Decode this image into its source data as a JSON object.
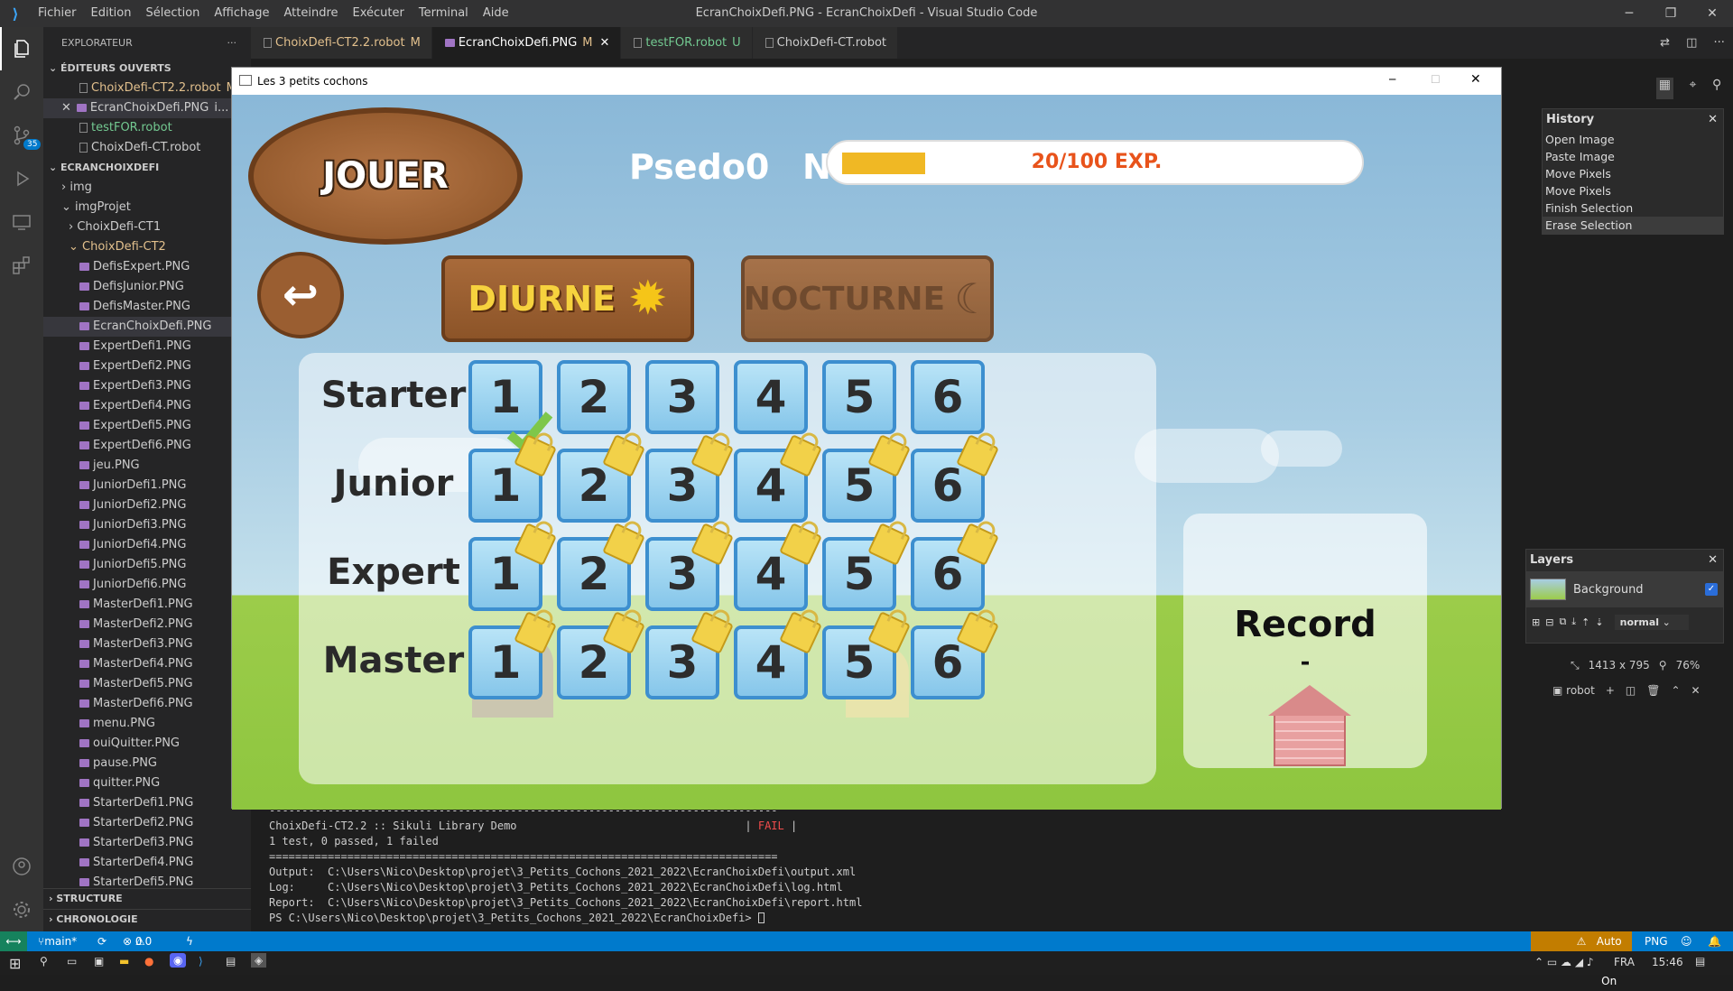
{
  "vscode": {
    "window_title": "EcranChoixDefi.PNG - EcranChoixDefi - Visual Studio Code",
    "menu": [
      "Fichier",
      "Edition",
      "Sélection",
      "Affichage",
      "Atteindre",
      "Exécuter",
      "Terminal",
      "Aide"
    ],
    "explorer_title": "EXPLORATEUR",
    "open_editors_title": "ÉDITEURS OUVERTS",
    "open_editors": [
      {
        "name": "ChoixDefi-CT2.2.robot",
        "status": "M"
      },
      {
        "name": "EcranChoixDefi.PNG",
        "status": "i..."
      },
      {
        "name": "testFOR.robot",
        "status": ""
      },
      {
        "name": "ChoixDefi-CT.robot",
        "status": ""
      }
    ],
    "workspace_title": "ECRANCHOIXDEFI",
    "folders": [
      "img",
      "imgProjet",
      "ChoixDefi-CT1",
      "ChoixDefi-CT2"
    ],
    "files": [
      "DefisExpert.PNG",
      "DefisJunior.PNG",
      "DefisMaster.PNG",
      "EcranChoixDefi.PNG",
      "ExpertDefi1.PNG",
      "ExpertDefi2.PNG",
      "ExpertDefi3.PNG",
      "ExpertDefi4.PNG",
      "ExpertDefi5.PNG",
      "ExpertDefi6.PNG",
      "jeu.PNG",
      "JuniorDefi1.PNG",
      "JuniorDefi2.PNG",
      "JuniorDefi3.PNG",
      "JuniorDefi4.PNG",
      "JuniorDefi5.PNG",
      "JuniorDefi6.PNG",
      "MasterDefi1.PNG",
      "MasterDefi2.PNG",
      "MasterDefi3.PNG",
      "MasterDefi4.PNG",
      "MasterDefi5.PNG",
      "MasterDefi6.PNG",
      "menu.PNG",
      "ouiQuitter.PNG",
      "pause.PNG",
      "quitter.PNG",
      "StarterDefi1.PNG",
      "StarterDefi2.PNG",
      "StarterDefi3.PNG",
      "StarterDefi4.PNG",
      "StarterDefi5.PNG"
    ],
    "outline_title": "STRUCTURE",
    "timeline_title": "CHRONOLOGIE",
    "tabs": [
      {
        "name": "ChoixDefi-CT2.2.robot",
        "status": "M"
      },
      {
        "name": "EcranChoixDefi.PNG",
        "status": "M"
      },
      {
        "name": "testFOR.robot",
        "status": "U"
      },
      {
        "name": "ChoixDefi-CT.robot",
        "status": ""
      }
    ],
    "scm_badge": "35",
    "terminal": {
      "sep1": "------------------------------------------------------------------------------",
      "suite_line": "ChoixDefi-CT2.2 :: Sikuli Library Demo                                   | ",
      "suite_status": "FAIL",
      "suite_end": " |",
      "summary": "1 test, 0 passed, 1 failed",
      "sep2": "==============================================================================",
      "output": "Output:  C:\\Users\\Nico\\Desktop\\projet\\3_Petits_Cochons_2021_2022\\EcranChoixDefi\\output.xml",
      "log": "Log:     C:\\Users\\Nico\\Desktop\\projet\\3_Petits_Cochons_2021_2022\\EcranChoixDefi\\log.html",
      "report": "Report:  C:\\Users\\Nico\\Desktop\\projet\\3_Petits_Cochons_2021_2022\\EcranChoixDefi\\report.html",
      "prompt": "PS C:\\Users\\Nico\\Desktop\\projet\\3_Petits_Cochons_2021_2022\\EcranChoixDefi> "
    },
    "terminal_selector": "robot",
    "status": {
      "branch": "main*",
      "errors": "0",
      "warnings": "0",
      "autosave": "Auto Save is On",
      "lang": "PNG"
    }
  },
  "paint": {
    "history_title": "History",
    "history_items": [
      "Open Image",
      "Paste Image",
      "Move Pixels",
      "Move Pixels",
      "Finish Selection",
      "Erase Selection"
    ],
    "layers_title": "Layers",
    "layer_name": "Background",
    "blend_mode": "normal",
    "image_size": "1413 x 795",
    "zoom": "76%"
  },
  "game": {
    "window_title": "Les 3 petits cochons",
    "play_label": "JOUER",
    "player_name": "Psedo0",
    "level_label": "Niv. 2",
    "exp_text": "20/100 EXP.",
    "exp_fraction": 0.2,
    "day_label": "DIURNE",
    "night_label": "NOCTURNE",
    "rows": [
      "Starter",
      "Junior",
      "Expert",
      "Master"
    ],
    "levels": [
      "1",
      "2",
      "3",
      "4",
      "5",
      "6"
    ],
    "record_title": "Record",
    "record_value": "-"
  },
  "taskbar": {
    "lang": "FRA",
    "time": "15:46"
  },
  "colors": {
    "vscode_blue": "#007acc",
    "status_warn": "#c27d00",
    "exp_bar": "#f0b824",
    "tile_border": "#3d8fcf"
  }
}
